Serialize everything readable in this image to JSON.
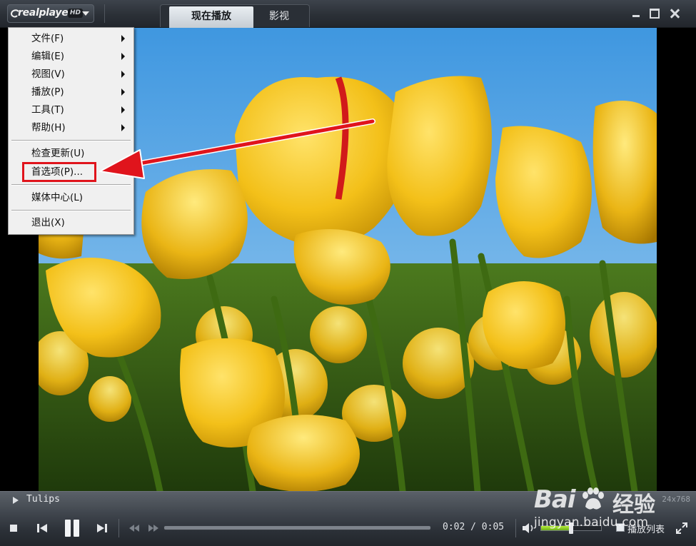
{
  "app": {
    "logo_text": "realplayer",
    "logo_badge": "HD"
  },
  "tabs": [
    {
      "label": "现在播放",
      "active": true
    },
    {
      "label": "影视",
      "active": false
    }
  ],
  "window_controls": {
    "minimize_icon": "minimize-icon",
    "maximize_icon": "maximize-icon",
    "close_icon": "close-icon"
  },
  "menu": {
    "items": [
      {
        "label": "文件(F)",
        "submenu": true
      },
      {
        "label": "编辑(E)",
        "submenu": true
      },
      {
        "label": "视图(V)",
        "submenu": true
      },
      {
        "label": "播放(P)",
        "submenu": true
      },
      {
        "label": "工具(T)",
        "submenu": true
      },
      {
        "label": "帮助(H)",
        "submenu": true
      },
      {
        "label": "检查更新(U)",
        "submenu": false
      },
      {
        "label": "首选项(P)...",
        "submenu": false,
        "highlighted": true
      },
      {
        "label": "媒体中心(L)",
        "submenu": false
      },
      {
        "label": "退出(X)",
        "submenu": false
      }
    ]
  },
  "now_playing": {
    "title": "Tulips",
    "resolution": "24x768"
  },
  "playback": {
    "current_time": "0:02",
    "separator": "/",
    "total_time": "0:05",
    "progress": 0.0,
    "volume": 0.5
  },
  "playlist": {
    "label": "播放列表"
  },
  "watermark": {
    "brand_left": "Bai",
    "brand_right": "经验",
    "url": "jingyan.baidu.com"
  },
  "colors": {
    "highlight_red": "#e0141c",
    "volume_green": "#8fd12a",
    "tab_active_bg": "#dde3e8"
  }
}
